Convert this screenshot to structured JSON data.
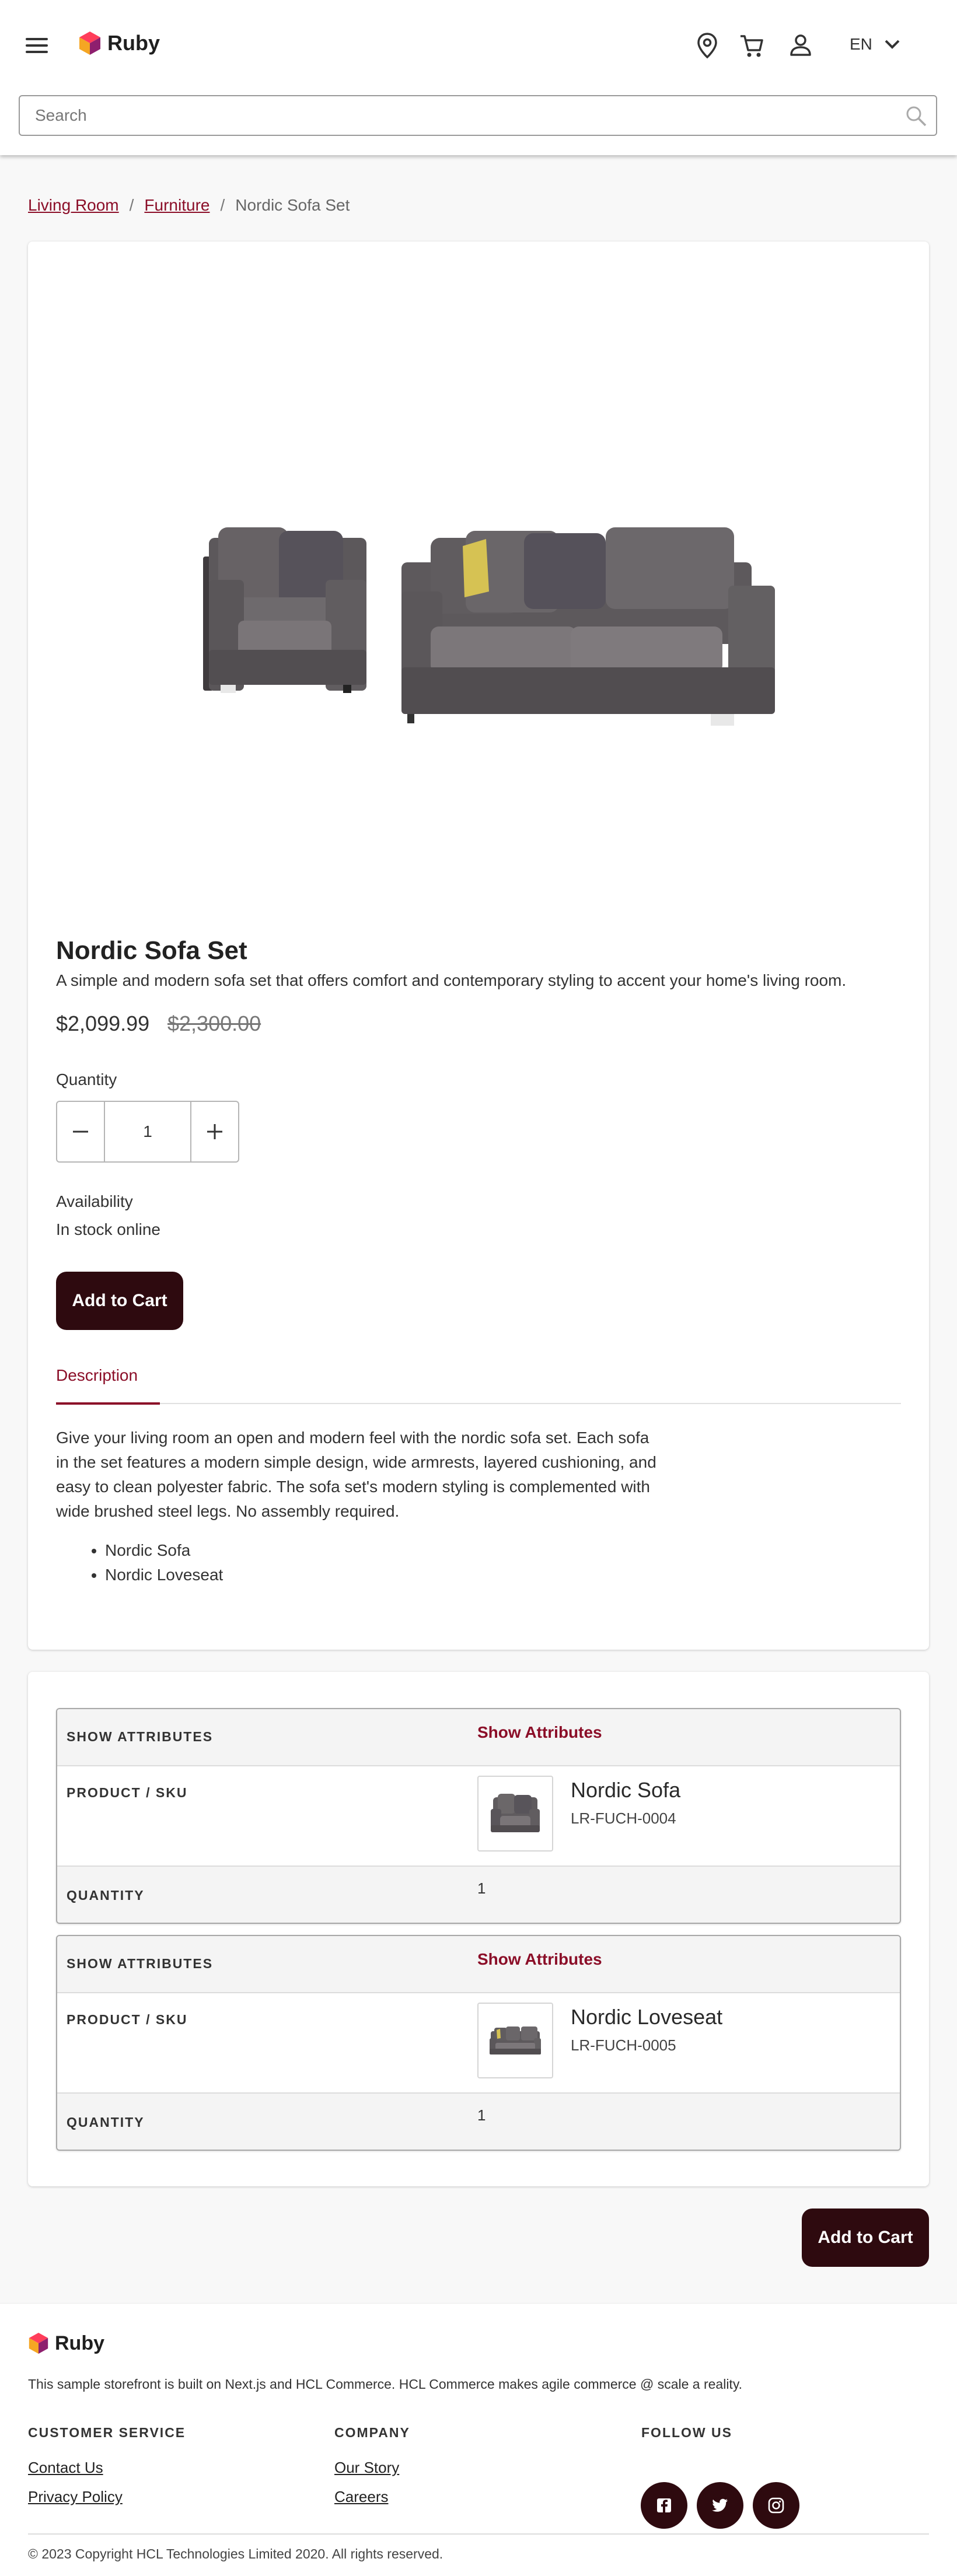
{
  "header": {
    "brand": "Ruby",
    "language": "EN",
    "search_placeholder": "Search",
    "icons": [
      "menu-icon",
      "location-pin-icon",
      "cart-icon",
      "user-icon",
      "chevron-down-icon",
      "search-icon"
    ]
  },
  "breadcrumb": {
    "items": [
      "Living Room",
      "Furniture"
    ],
    "current": "Nordic Sofa Set",
    "separator": "/"
  },
  "product": {
    "title": "Nordic Sofa Set",
    "short_description": "A simple and modern sofa set that offers comfort and contemporary styling to accent your home's living room.",
    "price": "$2,099.99",
    "original_price": "$2,300.00",
    "quantity_label": "Quantity",
    "quantity_value": "1",
    "availability_label": "Availability",
    "availability_value": "In stock online",
    "add_to_cart": "Add to Cart",
    "tab_label": "Description",
    "description": "Give your living room an open and modern feel with the nordic sofa set. Each sofa in the set features a modern simple design, wide armrests, layered cushioning, and easy to clean polyester fabric. The sofa set's modern styling is complemented with wide brushed steel legs. No assembly required.",
    "bundle_items": [
      "Nordic Sofa",
      "Nordic Loveseat"
    ]
  },
  "components": {
    "labels": {
      "show_attributes": "SHOW ATTRIBUTES",
      "product_sku": "PRODUCT / SKU",
      "quantity": "QUANTITY"
    },
    "show_attributes_link": "Show Attributes",
    "items": [
      {
        "name": "Nordic Sofa",
        "sku": "LR-FUCH-0004",
        "quantity": "1"
      },
      {
        "name": "Nordic Loveseat",
        "sku": "LR-FUCH-0005",
        "quantity": "1"
      }
    ],
    "add_to_cart": "Add to Cart"
  },
  "footer": {
    "brand": "Ruby",
    "tagline": "This sample storefront is built on Next.js and HCL Commerce. HCL Commerce makes agile commerce @ scale a reality.",
    "customer_service": {
      "heading": "CUSTOMER SERVICE",
      "links": [
        "Contact Us",
        "Privacy Policy"
      ]
    },
    "company": {
      "heading": "COMPANY",
      "links": [
        "Our Story",
        "Careers"
      ]
    },
    "follow_us": {
      "heading": "FOLLOW US",
      "icons": [
        "facebook-icon",
        "twitter-icon",
        "instagram-icon"
      ]
    },
    "copyright": "© 2023 Copyright HCL Technologies Limited 2020. All rights reserved."
  },
  "colors": {
    "accent": "#8b0e28",
    "button_dark": "#2e0a0f",
    "page_bg": "#f8f8f8"
  }
}
